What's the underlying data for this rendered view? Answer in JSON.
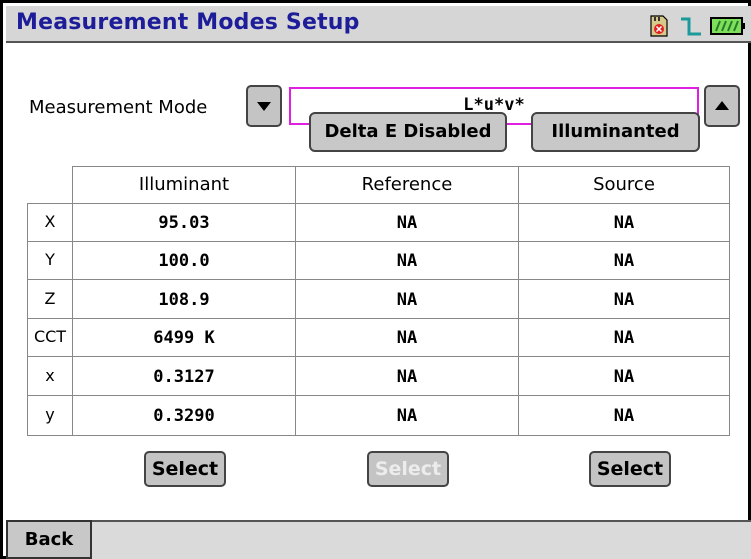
{
  "window": {
    "title": "Measurement Modes Setup",
    "icons": [
      "sd-card-icon",
      "trigger-signal-icon",
      "battery-icon"
    ]
  },
  "measurement_mode": {
    "label": "Measurement Mode",
    "value": "L*u*v*",
    "focus_color": "#e020e0"
  },
  "options": {
    "delta_e_label": "Delta E Disabled",
    "illuminant_label": "Illuminanted"
  },
  "table": {
    "columns": [
      "Illuminant",
      "Reference",
      "Source"
    ],
    "rows": [
      {
        "label": "X",
        "values": [
          "95.03",
          "NA",
          "NA"
        ]
      },
      {
        "label": "Y",
        "values": [
          "100.0",
          "NA",
          "NA"
        ]
      },
      {
        "label": "Z",
        "values": [
          "108.9",
          "NA",
          "NA"
        ]
      },
      {
        "label": "CCT",
        "values": [
          "6499 K",
          "NA",
          "NA"
        ]
      },
      {
        "label": "x",
        "values": [
          "0.3127",
          "NA",
          "NA"
        ]
      },
      {
        "label": "y",
        "values": [
          "0.3290",
          "NA",
          "NA"
        ]
      }
    ]
  },
  "select_buttons": [
    {
      "label": "Select",
      "enabled": true
    },
    {
      "label": "Select",
      "enabled": false
    },
    {
      "label": "Select",
      "enabled": true
    }
  ],
  "footer": {
    "back_label": "Back"
  },
  "colors": {
    "title_text": "#1d1d9a",
    "chrome_gray": "#d6d6d6",
    "button_gray": "#c4c4c4"
  }
}
